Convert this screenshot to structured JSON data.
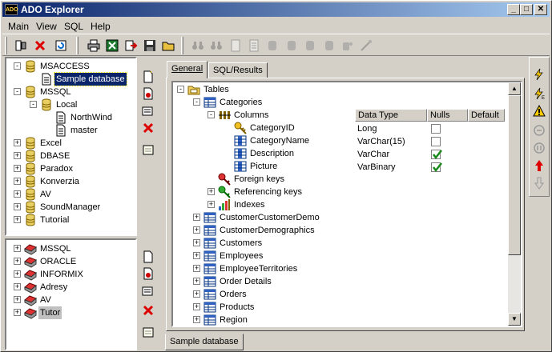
{
  "app": {
    "title": "ADO Explorer",
    "icon_text": "ADO"
  },
  "menu": [
    "Main",
    "View",
    "SQL",
    "Help"
  ],
  "toolbar": {
    "icons": [
      "connect-icon",
      "close-icon",
      "refresh-icon",
      "print-icon",
      "excel-icon",
      "export-icon",
      "save-icon",
      "open-icon",
      "binoculars-icon",
      "find-next-icon",
      "document-icon",
      "document2-icon",
      "db-icon",
      "db2-icon",
      "db3-icon",
      "db4-icon",
      "wand-icon"
    ]
  },
  "top_tree": {
    "items": [
      {
        "label": "MSACCESS"
      },
      {
        "label": "Sample database"
      },
      {
        "label": "MSSQL"
      },
      {
        "label": "Local"
      },
      {
        "label": "NorthWind"
      },
      {
        "label": "master"
      },
      {
        "label": "Excel"
      },
      {
        "label": "DBASE"
      },
      {
        "label": "Paradox"
      },
      {
        "label": "Konverzia"
      },
      {
        "label": "AV"
      },
      {
        "label": "SoundManager"
      },
      {
        "label": "Tutorial"
      }
    ]
  },
  "bottom_tree": {
    "items": [
      {
        "label": "MSSQL"
      },
      {
        "label": "ORACLE"
      },
      {
        "label": "INFORMIX"
      },
      {
        "label": "Adresy"
      },
      {
        "label": "AV"
      },
      {
        "label": "Tutor"
      }
    ]
  },
  "tabs": {
    "general": "General",
    "sql_results": "SQL/Results"
  },
  "bottom_tab": "Sample database",
  "schema_tree": {
    "root": "Tables",
    "table": "Categories",
    "columns_label": "Columns",
    "columns": [
      "CategoryID",
      "CategoryName",
      "Description",
      "Picture"
    ],
    "foreign_keys": "Foreign keys",
    "referencing_keys": "Referencing keys",
    "indexes": "Indexes",
    "tables": [
      "CustomerCustomerDemo",
      "CustomerDemographics",
      "Customers",
      "Employees",
      "EmployeeTerritories",
      "Order Details",
      "Orders",
      "Products",
      "Region"
    ]
  },
  "column_grid": {
    "headers": [
      "Data Type",
      "Nulls",
      "Default"
    ],
    "rows": [
      {
        "type": "Long",
        "nulls": false
      },
      {
        "type": "VarChar(15)",
        "nulls": false
      },
      {
        "type": "VarChar",
        "nulls": true
      },
      {
        "type": "VarBinary",
        "nulls": true
      }
    ]
  },
  "colors": {
    "title_start": "#0a246a",
    "title_end": "#a6caf0",
    "selection": "#0a246a",
    "check": "#1a8a1a"
  }
}
